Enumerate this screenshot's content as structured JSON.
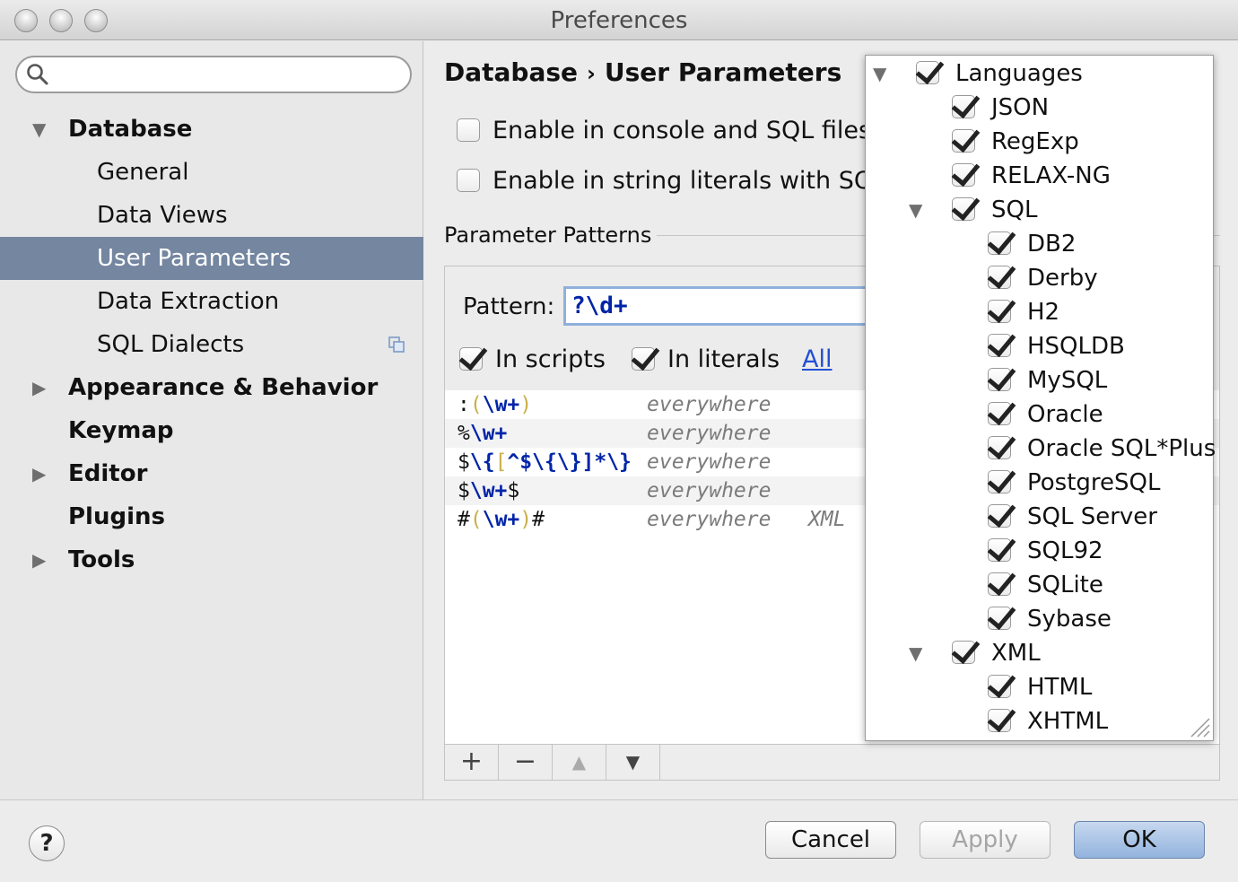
{
  "window": {
    "title": "Preferences"
  },
  "sidebar": {
    "search_placeholder": "",
    "items": [
      {
        "label": "Database",
        "level": 0,
        "bold": true,
        "expanded": true
      },
      {
        "label": "General",
        "level": 1
      },
      {
        "label": "Data Views",
        "level": 1
      },
      {
        "label": "User Parameters",
        "level": 1,
        "selected": true
      },
      {
        "label": "Data Extraction",
        "level": 1
      },
      {
        "label": "SQL Dialects",
        "level": 1
      },
      {
        "label": "Appearance & Behavior",
        "level": 0,
        "bold": true,
        "expandable": true
      },
      {
        "label": "Keymap",
        "level": 0,
        "bold": true
      },
      {
        "label": "Editor",
        "level": 0,
        "bold": true,
        "expandable": true
      },
      {
        "label": "Plugins",
        "level": 0,
        "bold": true
      },
      {
        "label": "Tools",
        "level": 0,
        "bold": true,
        "expandable": true
      }
    ]
  },
  "breadcrumb": {
    "part1": "Database",
    "separator": "›",
    "part2": "User Parameters"
  },
  "options": {
    "console": {
      "label": "Enable in console and SQL files",
      "checked": false
    },
    "literals": {
      "label": "Enable in string literals with SQL",
      "checked": false
    }
  },
  "patterns": {
    "section_title": "Parameter Patterns",
    "pattern_label": "Pattern:",
    "pattern_value": "?\\d+",
    "in_scripts": "In scripts",
    "in_literals": "In literals",
    "all_link": "All",
    "rows": [
      {
        "p1": ":",
        "p2": "(",
        "p3": "\\w+",
        "p4": ")",
        "p5": "",
        "scope": "everywhere",
        "lang": ""
      },
      {
        "p1": "%",
        "p2": "",
        "p3": "\\w+",
        "p4": "",
        "p5": "",
        "scope": "everywhere",
        "lang": ""
      },
      {
        "p1": "$",
        "p2": "",
        "p3": "\\{",
        "p4": "[",
        "p5": "^$\\{\\}]*\\}",
        "scope": "everywhere",
        "lang": ""
      },
      {
        "p1": "$",
        "p2": "",
        "p3": "\\w+",
        "p4": "",
        "p5": "$",
        "scope": "everywhere",
        "lang": ""
      },
      {
        "p1": "#",
        "p2": "(",
        "p3": "\\w+",
        "p4": ")",
        "p5": "#",
        "scope": "everywhere",
        "lang": "XML"
      }
    ],
    "toolbar": {
      "add": "+",
      "remove": "−",
      "up": "▲",
      "down": "▼"
    }
  },
  "popup": {
    "items": [
      {
        "label": "Languages",
        "level": 0,
        "expandable": true
      },
      {
        "label": "JSON",
        "level": 1
      },
      {
        "label": "RegExp",
        "level": 1
      },
      {
        "label": "RELAX-NG",
        "level": 1
      },
      {
        "label": "SQL",
        "level": 1,
        "expandable": true
      },
      {
        "label": "DB2",
        "level": 2
      },
      {
        "label": "Derby",
        "level": 2
      },
      {
        "label": "H2",
        "level": 2
      },
      {
        "label": "HSQLDB",
        "level": 2
      },
      {
        "label": "MySQL",
        "level": 2
      },
      {
        "label": "Oracle",
        "level": 2
      },
      {
        "label": "Oracle SQL*Plus",
        "level": 2
      },
      {
        "label": "PostgreSQL",
        "level": 2
      },
      {
        "label": "SQL Server",
        "level": 2
      },
      {
        "label": "SQL92",
        "level": 2
      },
      {
        "label": "SQLite",
        "level": 2
      },
      {
        "label": "Sybase",
        "level": 2
      },
      {
        "label": "XML",
        "level": 1,
        "expandable": true
      },
      {
        "label": "HTML",
        "level": 2
      },
      {
        "label": "XHTML",
        "level": 2
      }
    ]
  },
  "footer": {
    "help": "?",
    "cancel": "Cancel",
    "apply": "Apply",
    "ok": "OK"
  }
}
